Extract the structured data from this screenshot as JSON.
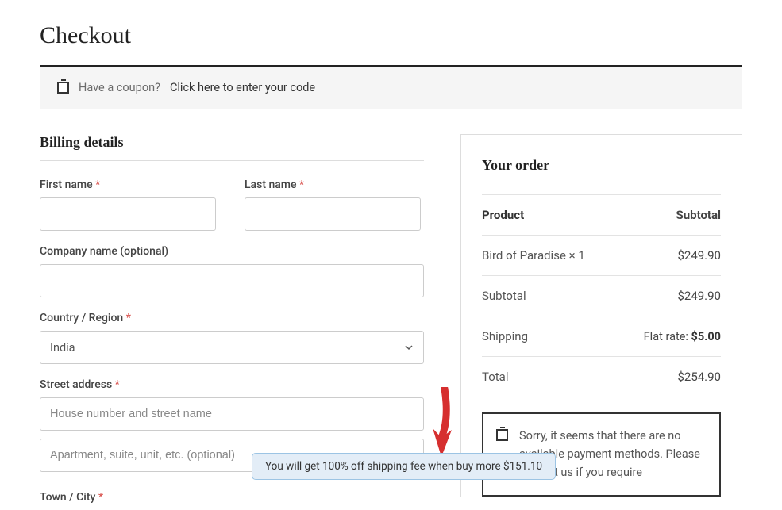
{
  "page": {
    "title": "Checkout"
  },
  "coupon": {
    "prompt": "Have a coupon?",
    "link": "Click here to enter your code"
  },
  "billing": {
    "heading": "Billing details",
    "first_name_label": "First name",
    "last_name_label": "Last name",
    "company_label": "Company name (optional)",
    "country_label": "Country / Region",
    "country_value": "India",
    "street_label": "Street address",
    "street_ph1": "House number and street name",
    "street_ph2": "Apartment, suite, unit, etc. (optional)",
    "town_label": "Town / City"
  },
  "order": {
    "heading": "Your order",
    "col_product": "Product",
    "col_subtotal": "Subtotal",
    "item_name": "Bird of Paradise × 1",
    "item_price": "$249.90",
    "subtotal_label": "Subtotal",
    "subtotal_value": "$249.90",
    "shipping_label": "Shipping",
    "shipping_rate_prefix": "Flat rate:",
    "shipping_rate_amount": "$5.00",
    "total_label": "Total",
    "total_value": "$254.90"
  },
  "payment_notice": "Sorry, it seems that there are no available payment methods. Please contact us if you require",
  "tooltip": "You will get 100% off shipping fee when buy more $151.10",
  "required_marker": "*"
}
